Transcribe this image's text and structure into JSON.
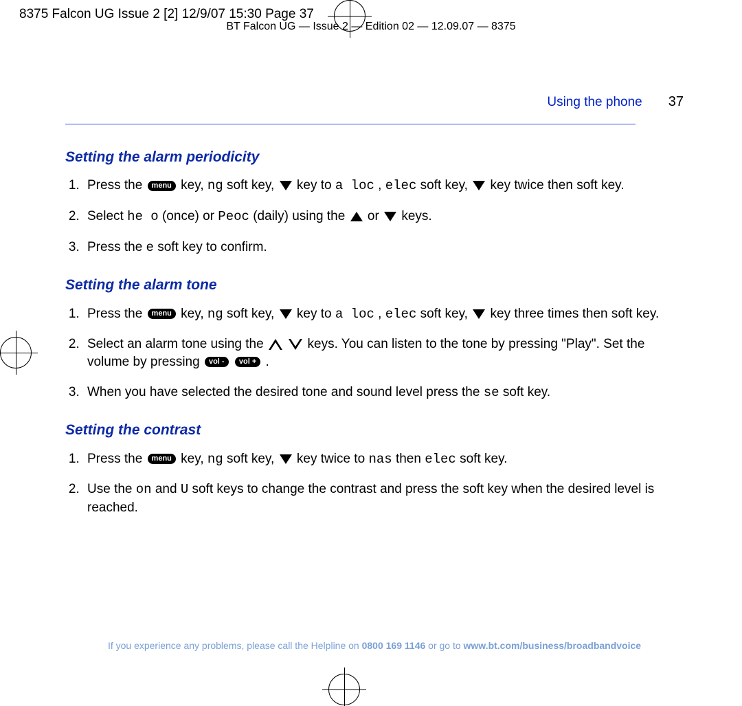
{
  "printmark": "8375 Falcon UG Issue 2 [2]  12/9/07  15:30  Page 37",
  "headerline": "BT Falcon UG — Issue 2 — Edition 02 — 12.09.07 — 8375",
  "runhead": {
    "section": "Using the phone",
    "pagenum": "37"
  },
  "sections": {
    "periodicity": {
      "title": "Setting the alarm periodicity",
      "items": [
        {
          "t1": "Press the ",
          "t2": " key, ",
          "t3": " soft key, ",
          "t4": " key to ",
          "code1": "a loc",
          "t5": ", ",
          "code2": "elec",
          "t6": " soft key, ",
          "t7": " key twice then ",
          "t8": " soft key."
        },
        {
          "t1": "Select ",
          "code1": "he o",
          "t2": " (once) or ",
          "code2": "Peoc",
          "t3": " (daily) using the ",
          "t4": " or ",
          "t5": " keys."
        },
        {
          "t1": "Press the ",
          "code1": "e",
          "t2": " soft key to confirm."
        }
      ]
    },
    "tone": {
      "title": "Setting the alarm tone",
      "items": [
        {
          "t1": "Press the ",
          "t2": " key, ",
          "t3": " soft key, ",
          "t4": " key to ",
          "code1": "a loc",
          "t5": ", ",
          "code2": "elec",
          "t6": " soft key, ",
          "t7": " key three times then ",
          "t8": " soft key."
        },
        {
          "t1": "Select an alarm tone using the ",
          "t2": " ",
          "t3": " keys. You can listen to the tone by pressing \"Play\". Set the volume by pressing ",
          "t4": " ",
          "t5": "."
        },
        {
          "t1": "When you have selected the desired tone and sound level press the ",
          "code1": "se",
          "t2": " soft key."
        }
      ]
    },
    "contrast": {
      "title": "Setting the contrast",
      "items": [
        {
          "t1": "Press the ",
          "t2": " key, ",
          "t3": " soft key, ",
          "t4": " key twice to ",
          "code1": "nas",
          "t5": " then ",
          "code2": "elec",
          "t6": " soft key."
        },
        {
          "t1": "Use the ",
          "code1": "on",
          "t2": " and ",
          "code2": "U",
          "t3": " soft keys to change the contrast and press the ",
          "t4": " soft key when the desired level is reached."
        }
      ]
    }
  },
  "icons": {
    "menu": "menu",
    "volminus": "vol -",
    "volplus": "vol +",
    "ng": "ng"
  },
  "footer": {
    "t1": "If you experience any problems, please call the Helpline on ",
    "phone": "0800 169 1146",
    "t2": " or go to ",
    "url": "www.bt.com/business/broadbandvoice"
  }
}
